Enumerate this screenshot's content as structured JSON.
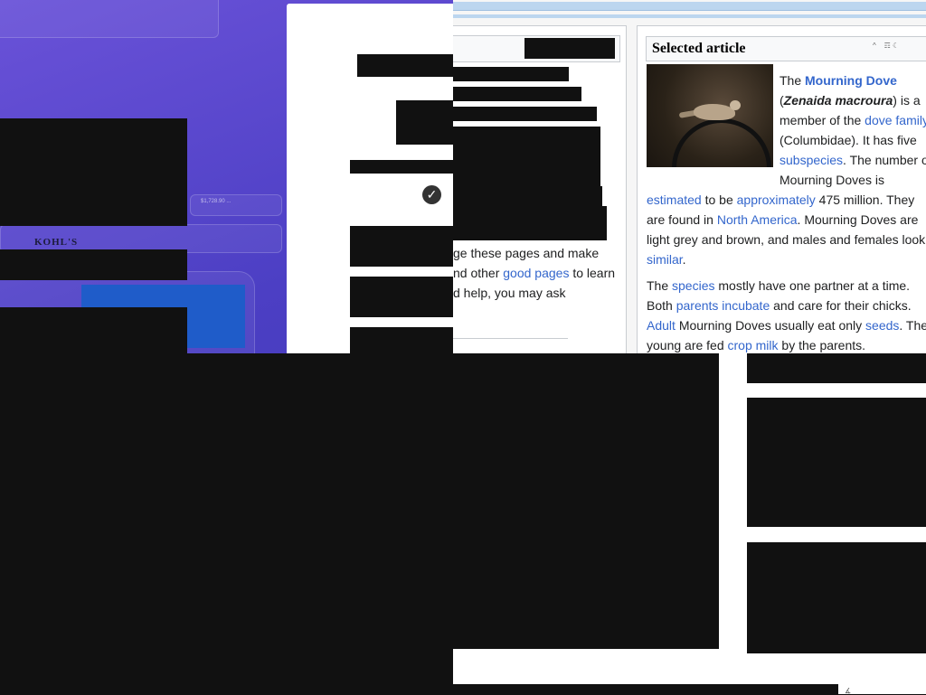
{
  "background_app": {
    "brand_text": "KOHL'S",
    "price_text": "$1,728.90 ..."
  },
  "dialog": {
    "check_icon": "check-circle-icon"
  },
  "left_column": {
    "line1_end": "ge these pages and make",
    "line2_pre": "nd other",
    "line2_link": "good pages",
    "line2_post": "to learn",
    "line3": "d help, you may ask"
  },
  "selected_article": {
    "title": "Selected article",
    "image_alt": "Mourning Dove on a perch",
    "lines": {
      "l1_pre": "The",
      "l1_link": "Mourning Dove",
      "l2_pre": "(",
      "l2_italic": "Zenaida macroura",
      "l2_post": ") is a",
      "l3_pre": "member of the",
      "l3_link": "dove family",
      "l4": "(Columbidae). It has five",
      "l5_link": "subspecies",
      "l5_post": ". The number of",
      "l6": "Mourning Doves is",
      "l7_link1": "estimated",
      "l7_mid": "to be",
      "l7_link2": "approximately",
      "l7_post": "475 million. They",
      "l8_pre": "are found in",
      "l8_link": "North America",
      "l8_post": ". Mourning Doves are",
      "l9": "light grey and brown, and males and females look",
      "l10_link": "similar",
      "l10_post": ".",
      "p2_l1_pre": "The",
      "p2_l1_link": "species",
      "p2_l1_post": "mostly have one partner at a time.",
      "p2_l2_pre": "Both",
      "p2_l2_link": "parents",
      "p2_l2_link2": "incubate",
      "p2_l2_post": "and care for their chicks.",
      "p2_l3_link": "Adult",
      "p2_l3_mid": "Mourning Doves usually eat only",
      "p2_l3_link2": "seeds",
      "p2_l3_post": ". The",
      "p2_l4_pre": "young are fed",
      "p2_l4_link": "crop milk",
      "p2_l4_post": "by the parents."
    }
  },
  "colors": {
    "link": "#3366cc",
    "redaction": "#111111",
    "background_purple": "#4c3fc4"
  }
}
